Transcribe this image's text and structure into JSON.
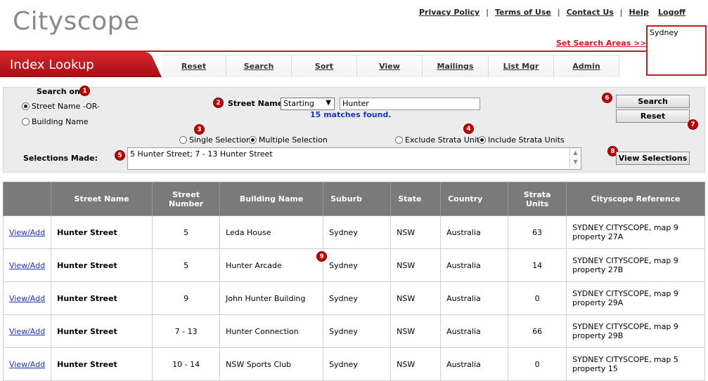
{
  "header": {
    "logo": "Cityscope",
    "links": [
      "Privacy Policy",
      "Terms of Use",
      "Contact Us",
      "Help"
    ],
    "logoff": "Logoff",
    "set_search_areas": "Set Search Areas >>",
    "search_area_value": "Sydney"
  },
  "nav": {
    "title": "Index Lookup",
    "tabs": [
      "Reset",
      "Search",
      "Sort",
      "View",
      "Mailings",
      "List Mgr",
      "Admin"
    ]
  },
  "search": {
    "search_on_label": "Search on",
    "option_street": "Street Name -OR-",
    "option_building": "Building Name",
    "street_name_label": "Street Name",
    "match_type": "Starting",
    "street_value": "Hunter",
    "matches": "15 matches found.",
    "single_selection": "Single Selection",
    "multiple_selection": "Multiple Selection",
    "exclude_strata": "Exclude Strata Units",
    "include_strata": "Include Strata Units",
    "selections_label": "Selections Made:",
    "selections_value": "5 Hunter Street; 7 - 13 Hunter Street",
    "search_button": "Search",
    "reset_button": "Reset",
    "view_selections_button": "View Selections"
  },
  "badges": [
    "1",
    "2",
    "3",
    "4",
    "5",
    "6",
    "7",
    "8",
    "9"
  ],
  "table": {
    "headers": [
      "",
      "Street Name",
      "Street Number",
      "Building Name",
      "Suburb",
      "State",
      "Country",
      "Strata Units",
      "Cityscope Reference"
    ],
    "rows": [
      {
        "action": "View/Add",
        "street": "Hunter Street",
        "number": "5",
        "building": "Leda House",
        "suburb": "Sydney",
        "state": "NSW",
        "country": "Australia",
        "strata": "63",
        "reference": "SYDNEY CITYSCOPE, map 9 property 27A"
      },
      {
        "action": "View/Add",
        "street": "Hunter Street",
        "number": "5",
        "building": "Hunter Arcade",
        "suburb": "Sydney",
        "state": "NSW",
        "country": "Australia",
        "strata": "14",
        "reference": "SYDNEY CITYSCOPE, map 9 property 27B"
      },
      {
        "action": "View/Add",
        "street": "Hunter Street",
        "number": "9",
        "building": "John Hunter Building",
        "suburb": "Sydney",
        "state": "NSW",
        "country": "Australia",
        "strata": "0",
        "reference": "SYDNEY CITYSCOPE, map 9 property 29A"
      },
      {
        "action": "View/Add",
        "street": "Hunter Street",
        "number": "7 - 13",
        "building": "Hunter Connection",
        "suburb": "Sydney",
        "state": "NSW",
        "country": "Australia",
        "strata": "66",
        "reference": "SYDNEY CITYSCOPE, map 9 property 29B"
      },
      {
        "action": "View/Add",
        "street": "Hunter Street",
        "number": "10 - 14",
        "building": "NSW Sports Club",
        "suburb": "Sydney",
        "state": "NSW",
        "country": "Australia",
        "strata": "0",
        "reference": "SYDNEY CITYSCOPE, map 5 property 15"
      }
    ]
  },
  "colors": {
    "accent": "#c81920",
    "link": "#1a35c4",
    "table_header": "#7a7a7a"
  }
}
